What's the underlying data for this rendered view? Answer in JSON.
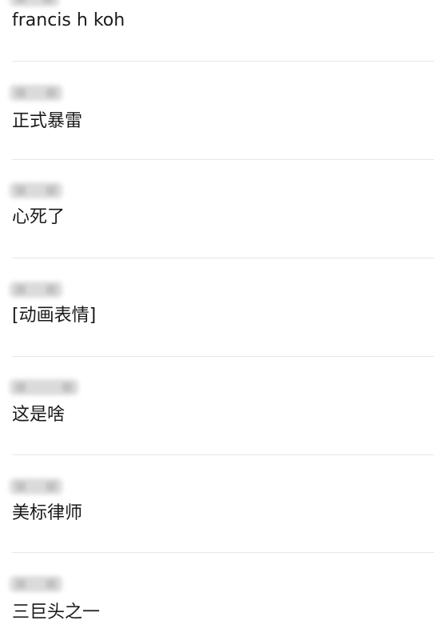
{
  "comments": [
    {
      "text": "francis h koh"
    },
    {
      "text": "正式暴雷"
    },
    {
      "text": "心死了"
    },
    {
      "text": "[动画表情]"
    },
    {
      "text": "这是啥"
    },
    {
      "text": "美标律师"
    },
    {
      "text": "三巨头之一"
    }
  ]
}
